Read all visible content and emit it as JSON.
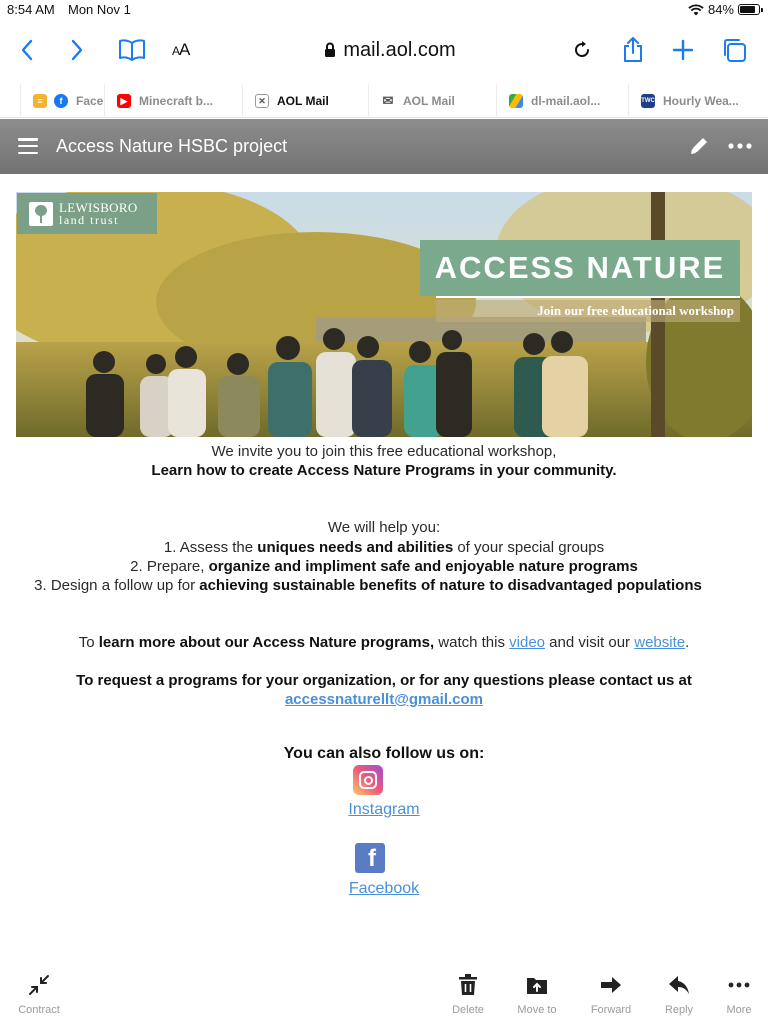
{
  "status": {
    "time": "8:54 AM",
    "date": "Mon Nov 1",
    "battery": "84%"
  },
  "browser": {
    "address": "mail.aol.com",
    "text_size_label": "AA",
    "tabs": [
      {
        "label": "",
        "icon": "generic-favicon-icon"
      },
      {
        "label": "Facebook",
        "icon": "facebook-icon"
      },
      {
        "label": "Minecraft b...",
        "icon": "youtube-icon"
      },
      {
        "label": "AOL Mail",
        "icon": "close-icon",
        "active": true
      },
      {
        "label": "AOL Mail",
        "icon": "mail-icon"
      },
      {
        "label": "dl-mail.aol...",
        "icon": "google-drive-icon"
      },
      {
        "label": "Hourly Wea...",
        "icon": "weather-channel-icon"
      }
    ]
  },
  "mail": {
    "subject": "Access Nature HSBC project",
    "banner": {
      "logo_line1": "LEWISBORO",
      "logo_line2": "land trust",
      "headline": "ACCESS NATURE",
      "subhead": "Join our free educational workshop"
    },
    "intro_line1": "We invite you to join this free educational workshop,",
    "intro_line2": "Learn how to create Access Nature Programs in your community.",
    "help_heading": "We will help you:",
    "steps": [
      {
        "pre": "1. Assess the ",
        "bold": "uniques needs and abilities",
        "post": " of your special groups"
      },
      {
        "pre": "2. Prepare, ",
        "bold": "organize and impliment safe and enjoyable nature programs",
        "post": ""
      },
      {
        "pre": "3. Design a follow up for ",
        "bold": "achieving sustainable benefits of nature to disadvantaged populations",
        "post": ""
      }
    ],
    "learn_pre": "To ",
    "learn_bold": "learn more about our Access Nature programs,",
    "learn_mid": " watch this ",
    "learn_video": "video",
    "learn_and": " and visit our ",
    "learn_website": "website",
    "learn_end": ".",
    "request_text": "To request a programs for your organization, or for any questions please contact us at",
    "email": "accessnaturellt@gmail.com",
    "follow_heading": "You can also follow us on:",
    "instagram_label": "Instagram",
    "facebook_label": "Facebook"
  },
  "bottom_toolbar": {
    "contract": "Contract",
    "delete": "Delete",
    "move_to": "Move to",
    "forward": "Forward",
    "reply": "Reply",
    "more": "More"
  },
  "colors": {
    "accent": "#1a7cf0",
    "link": "#4a90d9",
    "banner_green": "#7ba98c"
  }
}
